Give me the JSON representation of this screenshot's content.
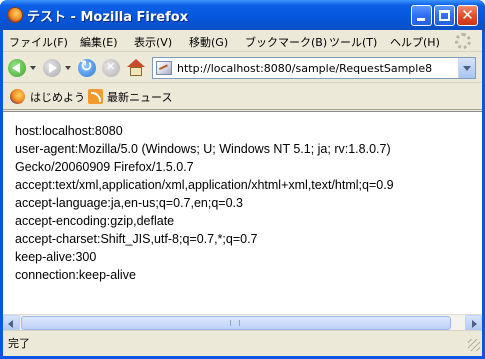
{
  "window": {
    "title": "テスト - Mozilla Firefox",
    "colors": {
      "titlebar": "#0556dc",
      "chrome": "#ece9d8",
      "close_button": "#e4502c"
    }
  },
  "menu": {
    "items": [
      {
        "label": "ファイル(F)"
      },
      {
        "label": "編集(E)"
      },
      {
        "label": "表示(V)"
      },
      {
        "label": "移動(G)"
      },
      {
        "label": "ブックマーク(B)"
      },
      {
        "label": "ツール(T)"
      },
      {
        "label": "ヘルプ(H)"
      }
    ]
  },
  "navigation": {
    "url": "http://localhost:8080/sample/RequestSample8",
    "icons": [
      "back-arrow-icon",
      "forward-arrow-icon",
      "reload-icon",
      "stop-icon",
      "home-icon",
      "page-icon",
      "dropdown-arrow-icon"
    ]
  },
  "bookmarks": {
    "items": [
      {
        "label": "はじめよう",
        "icon": "firefox-icon"
      },
      {
        "label": "最新ニュース",
        "icon": "rss-feed-icon"
      }
    ]
  },
  "content": {
    "lines": [
      "host:localhost:8080",
      "user-agent:Mozilla/5.0 (Windows; U; Windows NT 5.1; ja; rv:1.8.0.7)",
      "Gecko/20060909 Firefox/1.5.0.7",
      "accept:text/xml,application/xml,application/xhtml+xml,text/html;q=0.9",
      "accept-language:ja,en-us;q=0.7,en;q=0.3",
      "accept-encoding:gzip,deflate",
      "accept-charset:Shift_JIS,utf-8;q=0.7,*;q=0.7",
      "keep-alive:300",
      "connection:keep-alive"
    ]
  },
  "status": {
    "text": "完了"
  }
}
